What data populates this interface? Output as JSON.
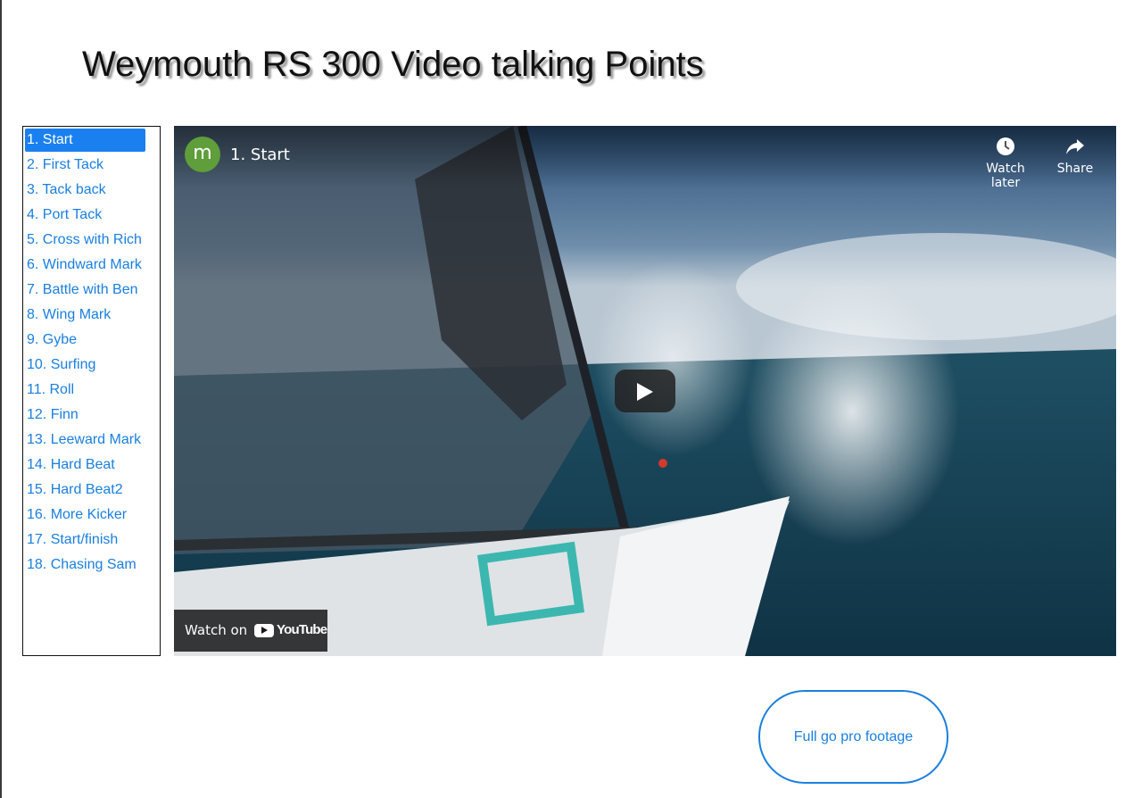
{
  "page": {
    "title": "Weymouth RS 300 Video talking Points"
  },
  "playlist": {
    "items": [
      {
        "label": "1. Start",
        "active": true
      },
      {
        "label": "2. First Tack"
      },
      {
        "label": "3. Tack back"
      },
      {
        "label": "4. Port Tack"
      },
      {
        "label": "5. Cross with Rich"
      },
      {
        "label": "6. Windward Mark"
      },
      {
        "label": "7. Battle with Ben"
      },
      {
        "label": "8. Wing Mark"
      },
      {
        "label": "9. Gybe"
      },
      {
        "label": "10. Surfing"
      },
      {
        "label": "11. Roll"
      },
      {
        "label": "12. Finn"
      },
      {
        "label": "13. Leeward Mark"
      },
      {
        "label": "14. Hard Beat"
      },
      {
        "label": "15. Hard Beat2"
      },
      {
        "label": "16. More Kicker"
      },
      {
        "label": "17. Start/finish"
      },
      {
        "label": "18. Chasing Sam"
      }
    ],
    "active_color": "#1a80f0",
    "link_color": "#1a7fe0"
  },
  "video": {
    "channel_initial": "m",
    "title": "1. Start",
    "watch_later_label": "Watch later",
    "share_label": "Share",
    "watch_on_label": "Watch on",
    "youtube_label": "YouTube",
    "icons": [
      "clock-icon",
      "share-arrow-icon",
      "play-icon",
      "youtube-logo-icon"
    ]
  },
  "footage_button": {
    "label": "Full go pro footage"
  }
}
